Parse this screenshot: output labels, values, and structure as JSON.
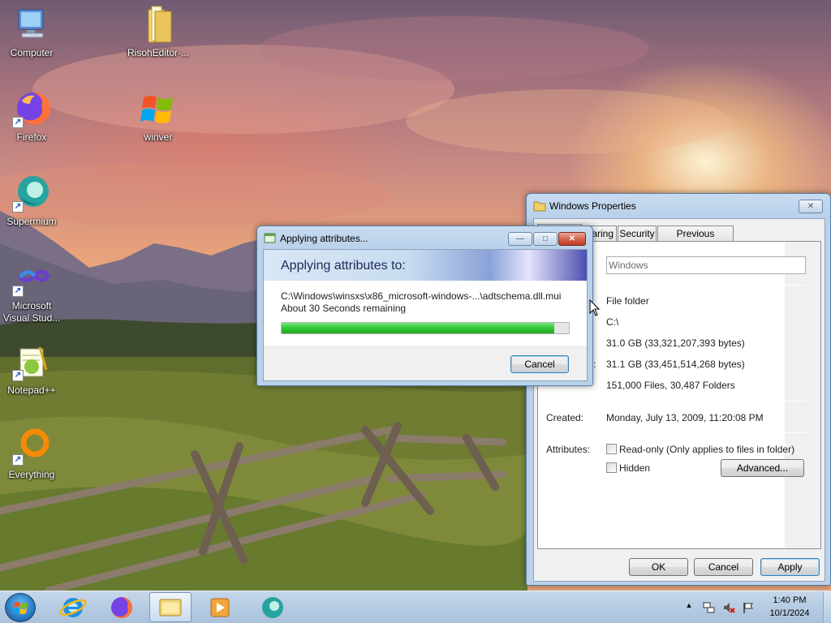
{
  "desktop": {
    "icons": [
      {
        "label": "Computer",
        "icon": "computer-icon"
      },
      {
        "label": "RisohEditor-...",
        "icon": "folder-icon"
      },
      {
        "label": "Firefox",
        "icon": "firefox-icon"
      },
      {
        "label": "winver",
        "icon": "windows-logo-icon"
      },
      {
        "label": "Supermium",
        "icon": "supermium-icon"
      },
      {
        "label": "Microsoft Visual Stud...",
        "icon": "visual-studio-icon"
      },
      {
        "label": "Notepad++",
        "icon": "notepadpp-icon"
      },
      {
        "label": "Everything",
        "icon": "everything-icon"
      }
    ]
  },
  "properties": {
    "title": "Windows Properties",
    "tabs": [
      "aring",
      "Security",
      "Previous Versions"
    ],
    "name_value": "Windows",
    "type_value": "File folder",
    "location_value": "C:\\",
    "size_value": "31.0 GB (33,321,207,393 bytes)",
    "size_on_disk_label": "k:",
    "size_on_disk_value": "31.1 GB (33,451,514,268 bytes)",
    "contains_value": "151,000 Files, 30,487 Folders",
    "created_label": "Created:",
    "created_value": "Monday, July 13, 2009, 11:20:08 PM",
    "attributes_label": "Attributes:",
    "readonly_label": "Read-only (Only applies to files in folder)",
    "hidden_label": "Hidden",
    "advanced_label": "Advanced...",
    "ok_label": "OK",
    "cancel_label": "Cancel",
    "apply_label": "Apply",
    "close_glyph": "✕"
  },
  "applying": {
    "title": "Applying attributes...",
    "header": "Applying attributes to:",
    "path": "C:\\Windows\\winsxs\\x86_microsoft-windows-...\\adtschema.dll.mui",
    "remaining": "About 30 Seconds remaining",
    "progress": 0.95,
    "cancel_label": "Cancel",
    "min_glyph": "—",
    "max_glyph": "□",
    "close_glyph": "✕"
  },
  "taskbar": {
    "items": [
      "internet-explorer-icon",
      "firefox-icon",
      "explorer-icon",
      "media-player-icon",
      "supermium-icon"
    ],
    "time": "1:40 PM",
    "date": "10/1/2024",
    "tray_chevron": "▲"
  },
  "colors": {
    "progress_green": "#2fc83a",
    "title_blue": "#b9d1ea"
  }
}
